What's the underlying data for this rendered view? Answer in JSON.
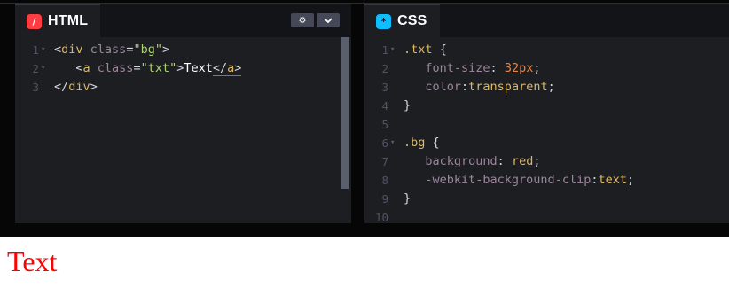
{
  "html_editor": {
    "tab_label": "HTML",
    "badge_glyph": "/",
    "settings_icon": "gear-icon",
    "dropdown_icon": "chevron-down-icon",
    "lines": [
      {
        "num": "1",
        "fold": "▾",
        "tokens": [
          {
            "t": "<",
            "c": "t-pun"
          },
          {
            "t": "div",
            "c": "t-tag"
          },
          {
            "t": " ",
            "c": "t-pun"
          },
          {
            "t": "class",
            "c": "t-attr"
          },
          {
            "t": "=",
            "c": "t-pun"
          },
          {
            "t": "\"bg\"",
            "c": "t-str"
          },
          {
            "t": ">",
            "c": "t-pun"
          }
        ]
      },
      {
        "num": "2",
        "fold": "▾",
        "tokens": [
          {
            "t": "   <",
            "c": "t-pun"
          },
          {
            "t": "a",
            "c": "t-tag"
          },
          {
            "t": " ",
            "c": "t-pun"
          },
          {
            "t": "class",
            "c": "t-attr"
          },
          {
            "t": "=",
            "c": "t-pun"
          },
          {
            "t": "\"txt\"",
            "c": "t-str"
          },
          {
            "t": ">",
            "c": "t-pun"
          },
          {
            "t": "Text",
            "c": "t-text"
          },
          {
            "t": "</",
            "c": "t-pun underline"
          },
          {
            "t": "a",
            "c": "t-tag underline"
          },
          {
            "t": ">",
            "c": "t-pun underline"
          }
        ]
      },
      {
        "num": "3",
        "fold": "",
        "tokens": [
          {
            "t": "</",
            "c": "t-pun"
          },
          {
            "t": "div",
            "c": "t-tag"
          },
          {
            "t": ">",
            "c": "t-pun"
          }
        ]
      }
    ]
  },
  "css_editor": {
    "tab_label": "CSS",
    "badge_glyph": "*",
    "lines": [
      {
        "num": "1",
        "fold": "▾",
        "tokens": [
          {
            "t": ".txt",
            "c": "t-cls"
          },
          {
            "t": " {",
            "c": "t-pun"
          }
        ]
      },
      {
        "num": "2",
        "fold": "",
        "tokens": [
          {
            "t": "   ",
            "c": "t-pun"
          },
          {
            "t": "font-size",
            "c": "t-prop"
          },
          {
            "t": ": ",
            "c": "t-pun"
          },
          {
            "t": "32px",
            "c": "t-num"
          },
          {
            "t": ";",
            "c": "t-pun"
          }
        ]
      },
      {
        "num": "3",
        "fold": "",
        "tokens": [
          {
            "t": "   ",
            "c": "t-pun"
          },
          {
            "t": "color",
            "c": "t-prop"
          },
          {
            "t": ":",
            "c": "t-pun"
          },
          {
            "t": "transparent",
            "c": "t-val"
          },
          {
            "t": ";",
            "c": "t-pun"
          }
        ]
      },
      {
        "num": "4",
        "fold": "",
        "tokens": [
          {
            "t": "}",
            "c": "t-pun"
          }
        ]
      },
      {
        "num": "5",
        "fold": "",
        "tokens": []
      },
      {
        "num": "6",
        "fold": "▾",
        "tokens": [
          {
            "t": ".bg",
            "c": "t-cls"
          },
          {
            "t": " {",
            "c": "t-pun"
          }
        ]
      },
      {
        "num": "7",
        "fold": "",
        "tokens": [
          {
            "t": "   ",
            "c": "t-pun"
          },
          {
            "t": "background",
            "c": "t-prop"
          },
          {
            "t": ": ",
            "c": "t-pun"
          },
          {
            "t": "red",
            "c": "t-val"
          },
          {
            "t": ";",
            "c": "t-pun"
          }
        ]
      },
      {
        "num": "8",
        "fold": "",
        "tokens": [
          {
            "t": "   ",
            "c": "t-pun"
          },
          {
            "t": "-webkit-background-clip",
            "c": "t-prop"
          },
          {
            "t": ":",
            "c": "t-pun"
          },
          {
            "t": "text",
            "c": "t-val"
          },
          {
            "t": ";",
            "c": "t-pun"
          }
        ]
      },
      {
        "num": "9",
        "fold": "",
        "tokens": [
          {
            "t": "}",
            "c": "t-pun"
          }
        ]
      },
      {
        "num": "10",
        "fold": "",
        "tokens": []
      }
    ]
  },
  "preview": {
    "text": "Text",
    "color": "#ff0000"
  },
  "colors": {
    "html_badge": "#ff3c41",
    "css_badge": "#0ebeff",
    "editor_bg": "#1d1e22"
  }
}
